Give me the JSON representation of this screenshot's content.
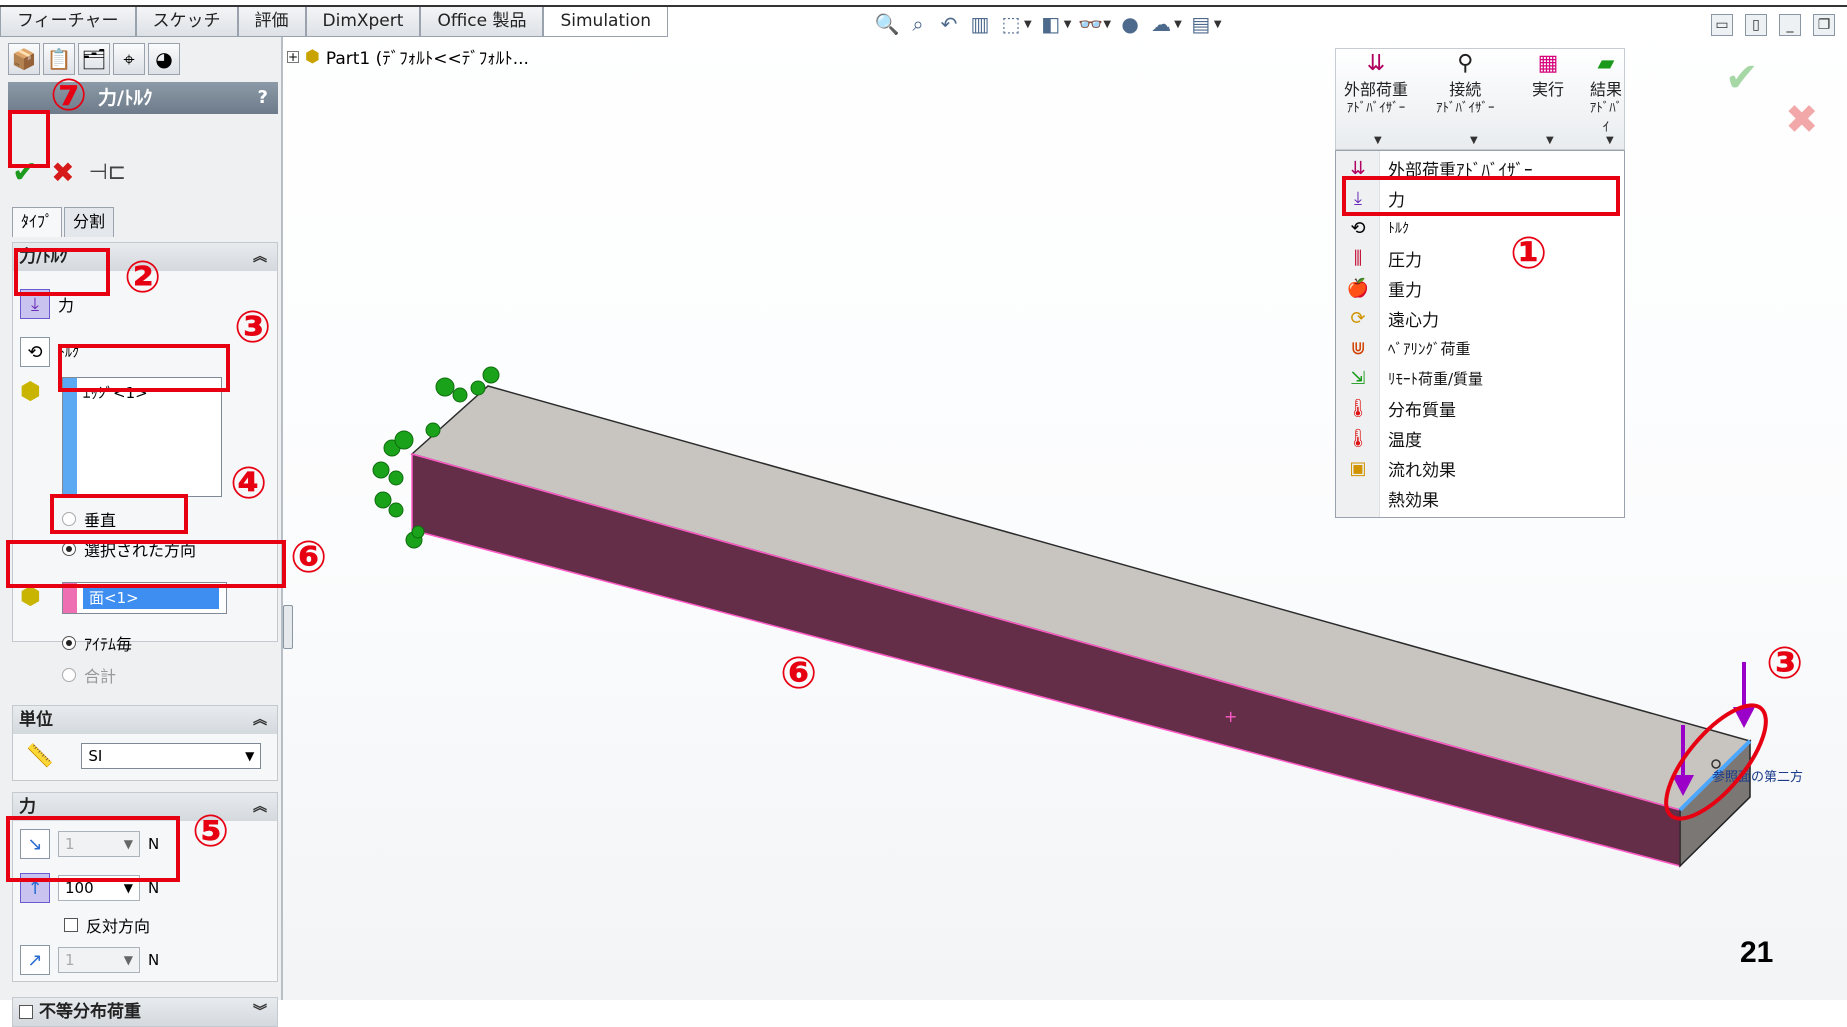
{
  "command_tabs": [
    "フィーチャー",
    "スケッチ",
    "評価",
    "DimXpert",
    "Office 製品",
    "Simulation"
  ],
  "active_tab_index": 5,
  "view_toolbar_icons": [
    "zoom-to-fit-icon",
    "zoom-area-icon",
    "previous-view-icon",
    "section-view-icon",
    "view-orientation-icon",
    "display-style-icon",
    "hide-show-items-icon",
    "edit-appearance-icon",
    "apply-scene-icon",
    "view-settings-icon"
  ],
  "feature_manager": {
    "tabs": [
      "featuremanager-tree-icon",
      "propertymanager-icon",
      "configuration-manager-icon",
      "dimxpert-manager-icon",
      "display-manager-icon"
    ]
  },
  "property_manager": {
    "title": "力/ﾄﾙｸ",
    "help": "?",
    "sub_tabs": [
      "ﾀｲﾌﾟ",
      "分割"
    ],
    "force_torque_group": {
      "header": "力/ﾄﾙｸ",
      "force_label": "力",
      "torque_label": "ﾄﾙｸ",
      "selection_item": "ｴｯｼﾞ<1>",
      "normal_label": "垂直",
      "selected_direction_label": "選択された方向",
      "direction_item": "面<1>",
      "per_item_label": "ｱｲﾃﾑ毎",
      "total_label": "合計"
    },
    "units_group": {
      "header": "単位",
      "unit_value": "SI"
    },
    "force_group": {
      "header": "力",
      "values": [
        "1",
        "100",
        "1"
      ],
      "unit": "N",
      "reverse_label": "反対方向"
    },
    "nonuniform_label": "不等分布荷重"
  },
  "tree": {
    "root_label": "Part1  (ﾃﾞﾌｫﾙﾄ<<ﾃﾞﾌｫﾙﾄ..."
  },
  "advisor_bar": {
    "buttons": [
      {
        "label_top": "外部荷重",
        "label_bottom": "ｱﾄﾞﾊﾞｲｻﾞｰ"
      },
      {
        "label_top": "接続",
        "label_bottom": "ｱﾄﾞﾊﾞｲｻﾞｰ"
      },
      {
        "label_top": "実行",
        "label_bottom": ""
      },
      {
        "label_top": "結果",
        "label_bottom": "ｱﾄﾞﾊﾞｲ"
      }
    ]
  },
  "loads_menu": {
    "items": [
      "外部荷重ｱﾄﾞﾊﾞｲｻﾞｰ",
      "力",
      "ﾄﾙｸ",
      "圧力",
      "重力",
      "遠心力",
      "ﾍﾞｱﾘﾝｸﾞ荷重",
      "ﾘﾓｰﾄ荷重/質量",
      "分布質量",
      "温度",
      "流れ効果",
      "熱効果"
    ]
  },
  "annotations": {
    "n1": "①",
    "n2": "②",
    "n3": "③",
    "n4": "④",
    "n5": "⑤",
    "n6": "⑥",
    "n7": "⑦"
  },
  "reference_label": "参照面の第二方",
  "page_number": "21",
  "colors": {
    "annotation_red": "#e60012",
    "beam_side": "#642e49",
    "beam_top": "#c8c5c1",
    "force_arrow": "#9b00c8",
    "fixture_green": "#1aa31a"
  }
}
